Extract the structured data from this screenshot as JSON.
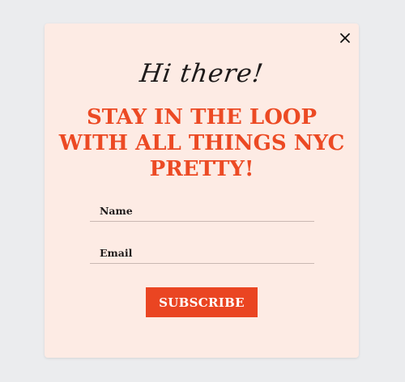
{
  "popup": {
    "greeting": "Hi there!",
    "headline": "STAY IN THE LOOP WITH ALL THINGS NYC PRETTY!",
    "close_icon": "close-icon",
    "fields": {
      "name_placeholder": "Name",
      "email_placeholder": "Email"
    },
    "subscribe_label": "SUBSCRIBE"
  },
  "colors": {
    "page_background": "#ebecee",
    "modal_background": "#fdebe4",
    "accent": "#ec4a24",
    "text": "#1e1a1a"
  }
}
